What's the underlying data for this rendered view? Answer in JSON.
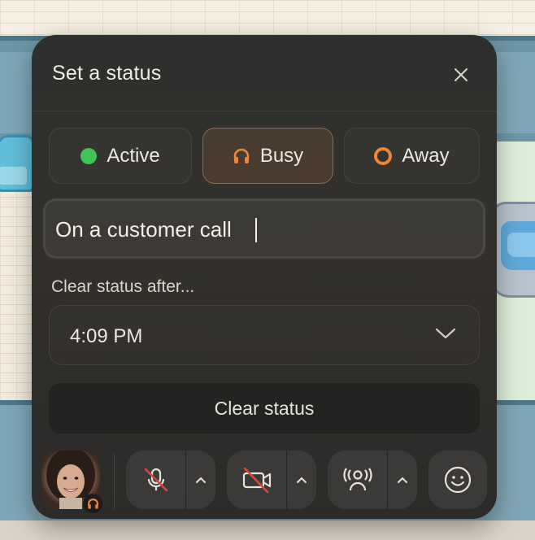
{
  "dialog": {
    "title": "Set a status",
    "close_icon": "close-icon"
  },
  "statuses": [
    {
      "label": "Active",
      "icon": "green-dot-icon",
      "color": "#3ec354",
      "selected": false
    },
    {
      "label": "Busy",
      "icon": "headphones-icon",
      "color": "#f0843a",
      "selected": true
    },
    {
      "label": "Away",
      "icon": "orange-ring-icon",
      "color": "#f0843a",
      "selected": false
    }
  ],
  "status_message": {
    "value": "On a customer call",
    "placeholder": ""
  },
  "clear_after": {
    "label": "Clear status after...",
    "selected": "4:09 PM"
  },
  "clear_button": {
    "label": "Clear status"
  },
  "toolbar": {
    "avatar_badge_icon": "headphones-icon",
    "mic": {
      "icon": "microphone-muted-icon",
      "muted": true
    },
    "camera": {
      "icon": "camera-off-icon",
      "off": true
    },
    "broadcast": {
      "icon": "broadcast-user-icon"
    },
    "emoji": {
      "icon": "smiley-icon"
    }
  },
  "colors": {
    "accent": "#f0843a",
    "active": "#3ec354",
    "muted_red": "#e0443a"
  }
}
